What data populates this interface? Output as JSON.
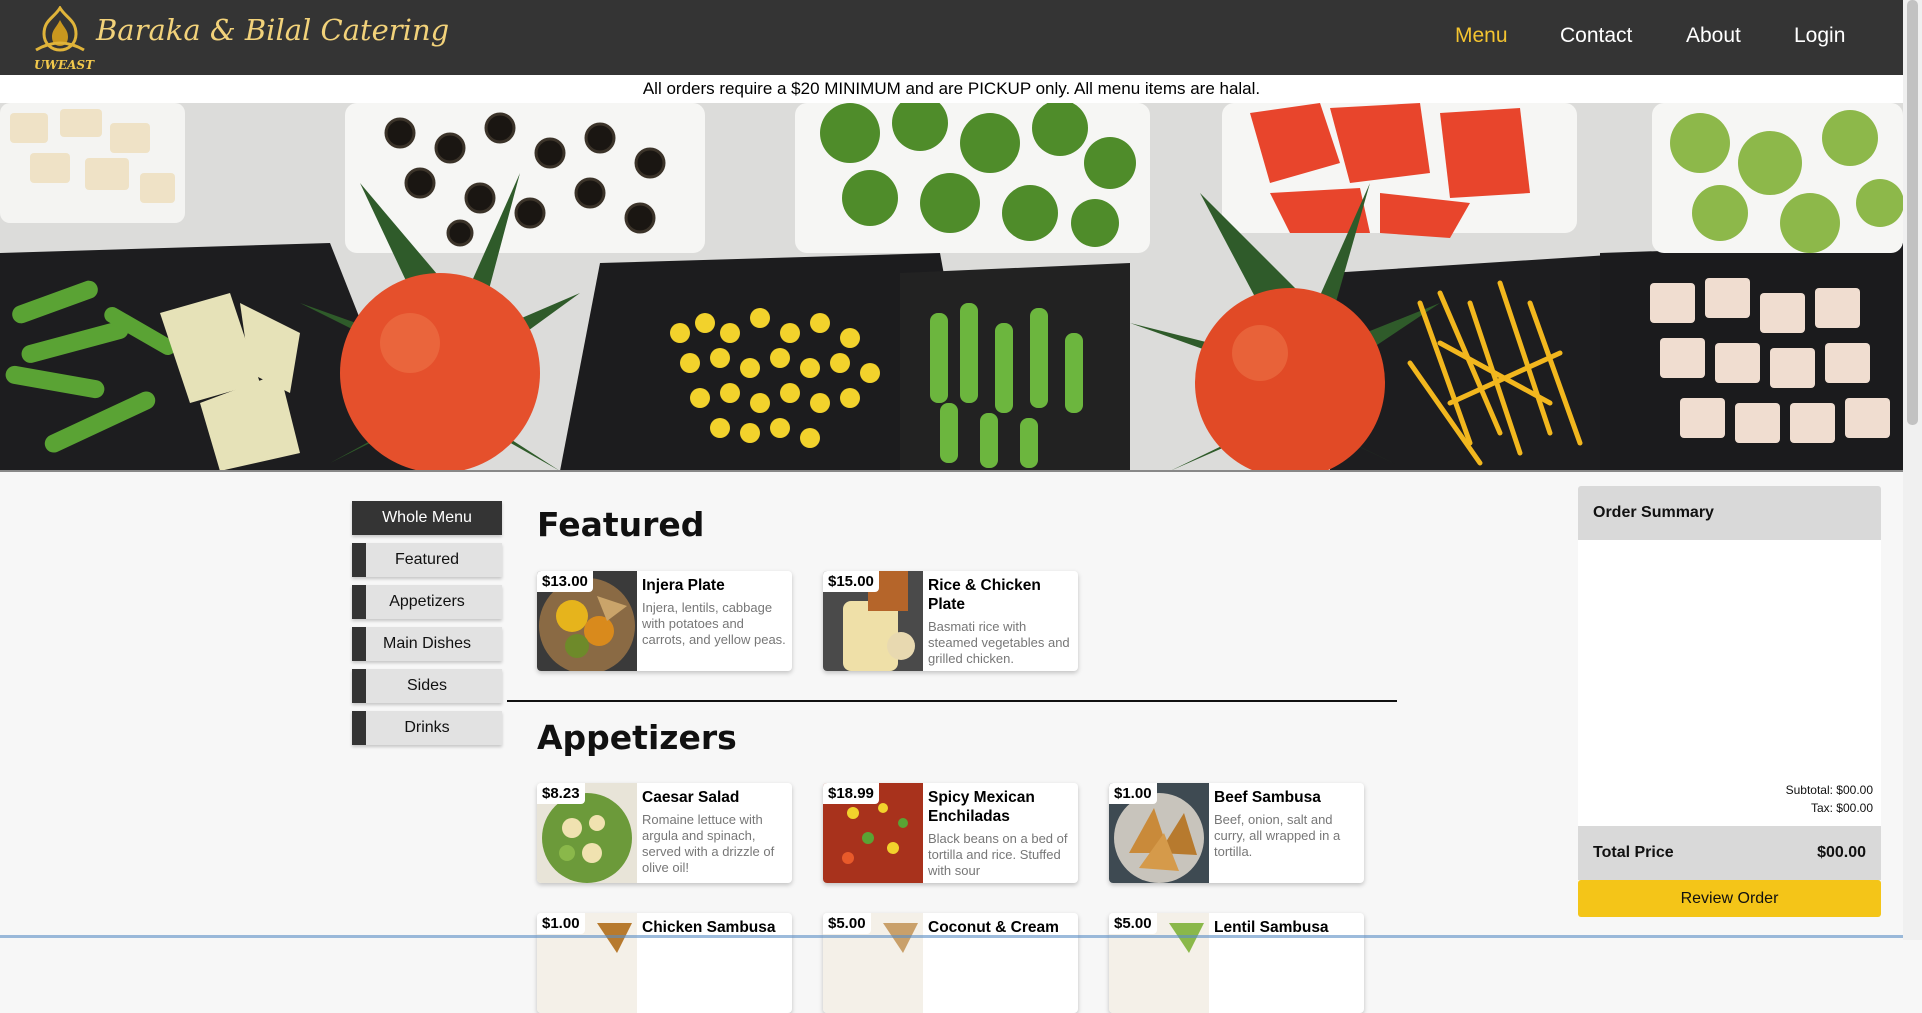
{
  "header": {
    "brand": "Baraka & Bilal Catering",
    "logo_sub": "UWEAST",
    "nav": [
      "Menu",
      "Contact",
      "About",
      "Login"
    ]
  },
  "notice": "All orders require a $20 MINIMUM and are PICKUP only. All menu items are halal.",
  "sidebar": [
    "Whole Menu",
    "Featured",
    "Appetizers",
    "Main Dishes",
    "Sides",
    "Drinks"
  ],
  "sections": {
    "featured": {
      "title": "Featured",
      "items": [
        {
          "price": "$13.00",
          "name": "Injera Plate",
          "desc": "Injera, lentils, cabbage with potatoes and carrots, and yellow peas."
        },
        {
          "price": "$15.00",
          "name": "Rice & Chicken Plate",
          "desc": "Basmati rice with steamed vegetables and grilled chicken."
        }
      ]
    },
    "appetizers": {
      "title": "Appetizers",
      "items": [
        {
          "price": "$8.23",
          "name": "Caesar Salad",
          "desc": "Romaine lettuce with argula and spinach, served with a drizzle of olive oil!"
        },
        {
          "price": "$18.99",
          "name": "Spicy Mexican Enchiladas",
          "desc": "Black beans on a bed of tortilla and rice. Stuffed with sour"
        },
        {
          "price": "$1.00",
          "name": "Beef Sambusa",
          "desc": "Beef, onion, salt and curry, all wrapped in a tortilla."
        },
        {
          "price": "$1.00",
          "name": "Chicken Sambusa",
          "desc": ""
        },
        {
          "price": "$5.00",
          "name": "Coconut & Cream",
          "desc": ""
        },
        {
          "price": "$5.00",
          "name": "Lentil Sambusa",
          "desc": ""
        }
      ]
    }
  },
  "order_summary": {
    "title": "Order Summary",
    "subtotal": "Subtotal: $00.00",
    "tax": "Tax: $00.00",
    "total_label": "Total Price",
    "total_value": "$00.00",
    "review_button": "Review Order"
  },
  "colors": {
    "header_bg": "#343434",
    "accent": "#f4c430",
    "review_button": "#f4c518"
  }
}
